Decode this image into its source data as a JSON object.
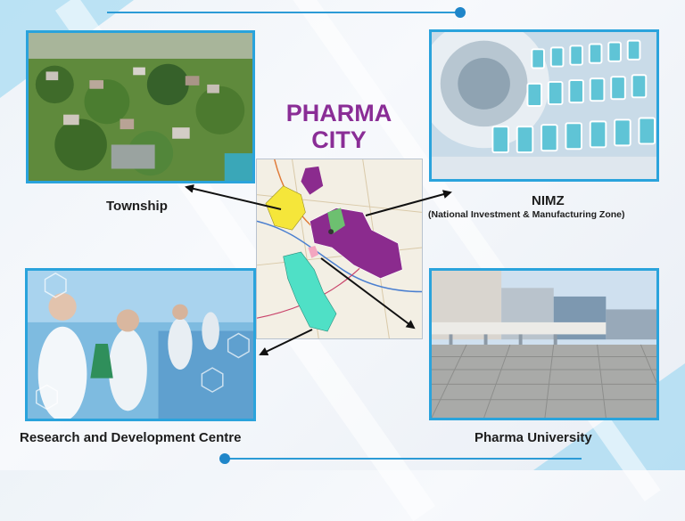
{
  "title": {
    "line1": "PHARMA",
    "line2": "CITY"
  },
  "labels": {
    "township": "Township",
    "nimz": "NIMZ",
    "nimz_full": "(National Investment & Manufacturing Zone)",
    "rd": "Research and Development Centre",
    "university": "Pharma University"
  },
  "colors": {
    "title": "#8a2d96",
    "frame": "#2aa3dc",
    "accent_line": "#2c9bd6",
    "map_zone_purple": "#8b2b8e",
    "map_zone_yellow": "#f5e63a",
    "map_zone_teal": "#4fe0c6"
  },
  "icons": [
    "township-photo",
    "vials-photo",
    "laboratory-photo",
    "campus-photo",
    "site-map"
  ]
}
